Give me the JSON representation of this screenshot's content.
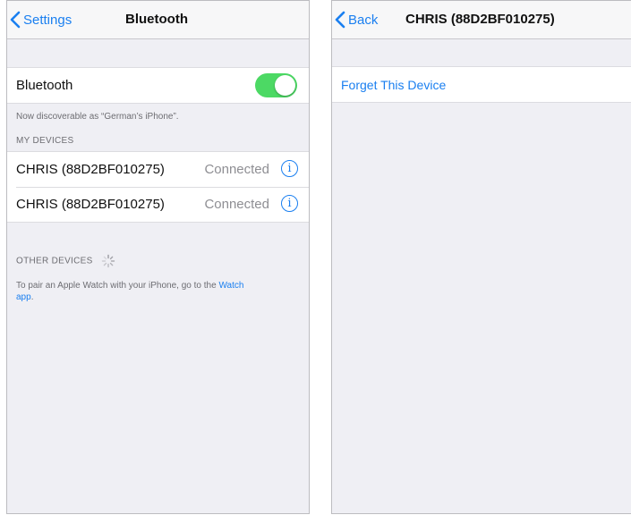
{
  "left_screen": {
    "navbar": {
      "back_label": "Settings",
      "title": "Bluetooth"
    },
    "bluetooth_row": {
      "label": "Bluetooth",
      "toggle_on": true
    },
    "discoverable_text": "Now discoverable as “German’s iPhone”.",
    "my_devices": {
      "header": "MY DEVICES",
      "items": [
        {
          "name": "CHRIS (88D2BF010275)",
          "status": "Connected"
        },
        {
          "name": "CHRIS (88D2BF010275)",
          "status": "Connected"
        }
      ]
    },
    "other_devices": {
      "header": "OTHER DEVICES",
      "pair_text_prefix": "To pair an Apple Watch with your iPhone, go to the ",
      "pair_link_1": "Watch",
      "pair_link_2": "app",
      "pair_text_suffix": "."
    }
  },
  "right_screen": {
    "navbar": {
      "back_label": "Back",
      "title": "CHRIS (88D2BF010275)"
    },
    "actions": {
      "forget_label": "Forget This Device"
    }
  },
  "icons": {
    "back": "chevron-left-icon",
    "info": "info-icon",
    "spinner": "activity-spinner-icon"
  },
  "colors": {
    "accent": "#1a7ff0",
    "toggle_on": "#4cd964",
    "background": "#efeff4",
    "secondary_text": "#8e8e93"
  }
}
